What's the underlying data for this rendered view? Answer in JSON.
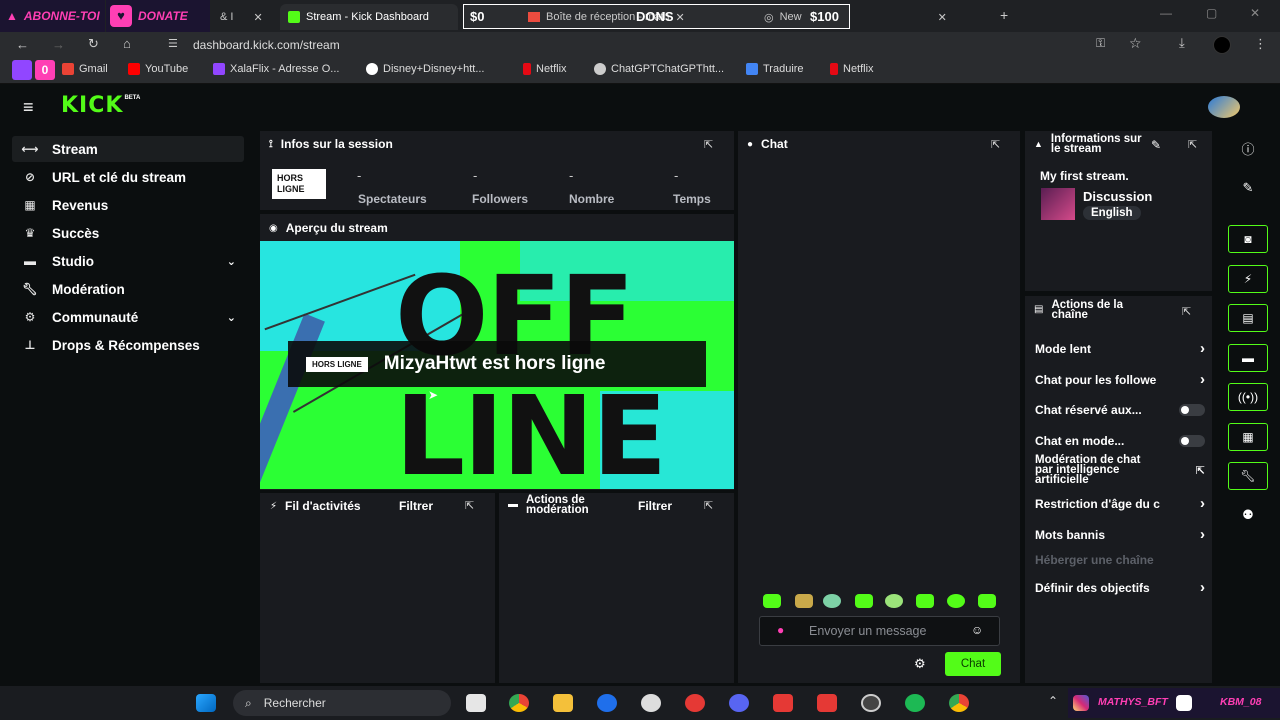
{
  "overlay": {
    "subscribe": "ABONNE-TOI",
    "donate": "DONATE",
    "goal_start": "$0",
    "goal_title": "DONS",
    "goal_end": "$100",
    "social_left": "MATHYS_BFT",
    "social_right": "KBM_08"
  },
  "browser": {
    "tabs": [
      {
        "label": "& I"
      },
      {
        "label": "Stream - Kick Dashboard"
      },
      {
        "label": "Boîte de réception - math"
      },
      {
        "label": "New"
      }
    ],
    "url": "dashboard.kick.com/stream",
    "bookmarks": [
      {
        "label": "Gmail",
        "color": "#ea4335"
      },
      {
        "label": "YouTube",
        "color": "#ff0000"
      },
      {
        "label": "XalaFlix - Adresse O...",
        "color": "#9146ff"
      },
      {
        "label": "Disney+Disney+htt...",
        "color": "#4285f4"
      },
      {
        "label": "Netflix",
        "color": "#e50914"
      },
      {
        "label": "ChatGPTChatGPThtt...",
        "color": "#cccccc"
      },
      {
        "label": "Traduire",
        "color": "#4285f4"
      },
      {
        "label": "Netflix",
        "color": "#e50914"
      }
    ]
  },
  "app": {
    "logo": "KICK",
    "logo_badge": "BETA"
  },
  "sidebar": {
    "items": [
      {
        "label": "Stream",
        "icon": "stream-icon"
      },
      {
        "label": "URL et clé du stream",
        "icon": "link-icon"
      },
      {
        "label": "Revenus",
        "icon": "revenue-icon"
      },
      {
        "label": "Succès",
        "icon": "trophy-icon"
      },
      {
        "label": "Studio",
        "icon": "studio-icon"
      },
      {
        "label": "Modération",
        "icon": "wrench-icon"
      },
      {
        "label": "Communauté",
        "icon": "community-icon"
      },
      {
        "label": "Drops & Récompenses",
        "icon": "drops-icon"
      }
    ]
  },
  "session": {
    "title": "Infos sur la session",
    "status_badge": "HORS LIGNE",
    "stats": [
      {
        "value": "-",
        "label": "Spectateurs"
      },
      {
        "value": "-",
        "label": "Followers"
      },
      {
        "value": "-",
        "label": "Nombre"
      },
      {
        "value": "-",
        "label": "Temps"
      }
    ]
  },
  "preview": {
    "title": "Aperçu du stream",
    "badge": "HORS LIGNE",
    "message": "MizyaHtwt est hors ligne",
    "bg_letters_top": "OFF",
    "bg_letters_bottom": "LINE"
  },
  "activity": {
    "title": "Fil d'activités",
    "filter": "Filtrer"
  },
  "modactions": {
    "title": "Actions de modération",
    "filter": "Filtrer"
  },
  "chat": {
    "title": "Chat",
    "placeholder": "Envoyer un message",
    "send": "Chat"
  },
  "info": {
    "title": "Informations sur le stream",
    "stream_title": "My first stream.",
    "category": "Discussion",
    "language": "English"
  },
  "channel_actions": {
    "title": "Actions de la chaîne",
    "items": [
      {
        "label": "Mode lent",
        "type": "arrow"
      },
      {
        "label": "Chat pour les followe",
        "type": "arrow"
      },
      {
        "label": "Chat réservé aux...",
        "type": "toggle"
      },
      {
        "label": "Chat en mode...",
        "type": "toggle"
      },
      {
        "label": "Modération de chat par intelligence artificielle",
        "type": "external"
      },
      {
        "label": "Restriction d'âge du c",
        "type": "arrow"
      },
      {
        "label": "Mots bannis",
        "type": "arrow"
      },
      {
        "label": "Héberger une chaîne",
        "type": "disabled"
      },
      {
        "label": "Définir des objectifs",
        "type": "arrow"
      }
    ]
  },
  "taskbar": {
    "search": "Rechercher"
  },
  "colors": {
    "accent": "#53fc18",
    "panel": "#191b1f",
    "background": "#0b0e0f",
    "overlay_pink": "#ff3fb4"
  }
}
